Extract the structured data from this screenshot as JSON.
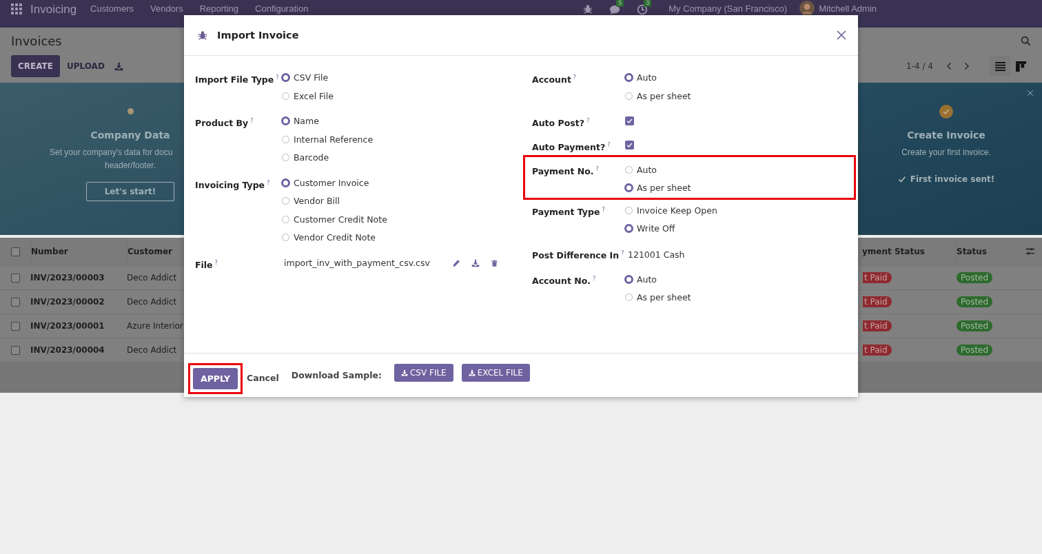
{
  "navbar": {
    "app": "Invoicing",
    "menu": [
      "Customers",
      "Vendors",
      "Reporting",
      "Configuration"
    ],
    "chat_count": "5",
    "activity_count": "3",
    "company": "My Company (San Francisco)",
    "user": "Mitchell Admin"
  },
  "control_panel": {
    "title": "Invoices",
    "create": "CREATE",
    "upload": "UPLOAD",
    "pager": "1-4 / 4"
  },
  "onboarding": {
    "steps": [
      {
        "title": "Company Data",
        "lines": [
          "Set your company's data for docu",
          "header/footer."
        ],
        "button": "Let's start!",
        "done": false
      },
      {
        "title": "Create Invoice",
        "lines": [
          "Create your first invoice."
        ],
        "done_text": "First invoice sent!",
        "done": true
      }
    ]
  },
  "table": {
    "all_selected": false,
    "columns": [
      "Number",
      "Customer",
      "yment Status",
      "Status"
    ],
    "rows": [
      {
        "selected": false,
        "number": "INV/2023/00003",
        "customer": "Deco Addict",
        "payment_status": "t Paid",
        "status": "Posted"
      },
      {
        "selected": false,
        "number": "INV/2023/00002",
        "customer": "Deco Addict",
        "payment_status": "t Paid",
        "status": "Posted"
      },
      {
        "selected": false,
        "number": "INV/2023/00001",
        "customer": "Azure Interior",
        "payment_status": "t Paid",
        "status": "Posted"
      },
      {
        "selected": false,
        "number": "INV/2023/00004",
        "customer": "Deco Addict",
        "payment_status": "t Paid",
        "status": "Posted"
      }
    ]
  },
  "dialog": {
    "title": "Import Invoice",
    "left_fields": [
      {
        "label": "Import File Type",
        "help": "?",
        "kind": "radio",
        "options": [
          {
            "label": "CSV File",
            "selected": true
          },
          {
            "label": "Excel File",
            "selected": false
          }
        ]
      },
      {
        "label": "Product By",
        "help": "?",
        "kind": "radio",
        "options": [
          {
            "label": "Name",
            "selected": true
          },
          {
            "label": "Internal Reference",
            "selected": false
          },
          {
            "label": "Barcode",
            "selected": false
          }
        ]
      },
      {
        "label": "Invoicing Type",
        "help": "?",
        "kind": "radio",
        "options": [
          {
            "label": "Customer Invoice",
            "selected": true
          },
          {
            "label": "Vendor Bill",
            "selected": false
          },
          {
            "label": "Customer Credit Note",
            "selected": false
          },
          {
            "label": "Vendor Credit Note",
            "selected": false
          }
        ]
      },
      {
        "label": "File",
        "help": "?",
        "kind": "file",
        "value": "import_inv_with_payment_csv.csv"
      }
    ],
    "right_fields": [
      {
        "label": "Account",
        "help": "?",
        "kind": "radio",
        "options": [
          {
            "label": "Auto",
            "selected": true
          },
          {
            "label": "As per sheet",
            "selected": false
          }
        ]
      },
      {
        "label": "Auto Post?",
        "help": "?",
        "kind": "checkbox",
        "checked": true
      },
      {
        "label": "Auto Payment?",
        "help": "?",
        "kind": "checkbox",
        "checked": true
      },
      {
        "label": "Payment No.",
        "help": "?",
        "kind": "radio",
        "highlighted": true,
        "options": [
          {
            "label": "Auto",
            "selected": false
          },
          {
            "label": "As per sheet",
            "selected": true
          }
        ]
      },
      {
        "label": "Payment Type",
        "help": "?",
        "kind": "radio",
        "options": [
          {
            "label": "Invoice Keep Open",
            "selected": false
          },
          {
            "label": "Write Off",
            "selected": true
          }
        ]
      },
      {
        "label": "Post Difference In",
        "help": "?",
        "kind": "text",
        "value": "121001 Cash"
      },
      {
        "label": "Account No.",
        "help": "?",
        "kind": "radio",
        "options": [
          {
            "label": "Auto",
            "selected": true
          },
          {
            "label": "As per sheet",
            "selected": false
          }
        ]
      }
    ],
    "footer": {
      "apply": "APPLY",
      "apply_highlighted": true,
      "cancel": "Cancel",
      "sample_label": "Download Sample:",
      "sample_buttons": [
        "CSV FILE",
        "EXCEL FILE"
      ]
    }
  }
}
